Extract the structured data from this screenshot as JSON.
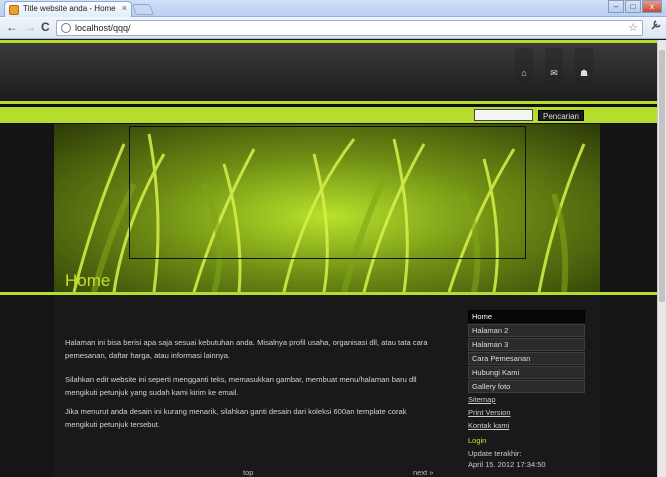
{
  "browser": {
    "tab_title": "Title website anda - Home",
    "tab_close": "×",
    "url": "localhost/qqq/",
    "icons": {
      "back": "←",
      "forward": "→",
      "reload": "C",
      "star": "☆",
      "wrench": "🔧",
      "minimize": "–",
      "maximize": "□",
      "close": "x"
    }
  },
  "header": {
    "icons": [
      "⌂",
      "✉",
      "☗"
    ]
  },
  "search": {
    "input_value": "",
    "button_label": "Pencarian"
  },
  "main": {
    "title": "Home",
    "paragraphs": [
      "Halaman ini bisa berisi apa saja sesuai kebutuhan anda. Misalnya profil usaha, organisasi dll, atau tata cara pemesanan, daftar harga, atau informasi lainnya.",
      "Silahkan edit website ini seperti mengganti teks, memasukkan gambar, membuat menu/halaman baru dll mengikuti petunjuk yang sudah kami kirim ke email.",
      "Jika menurut anda desain ini kurang menarik, silahkan ganti desain dari koleksi 600an template corak mengikuti petunjuk tersebut."
    ],
    "footer_top": "top",
    "footer_next": "next »"
  },
  "sidebar": {
    "menu": [
      "Home",
      "Halaman 2",
      "Halaman 3",
      "Cara Pemesanan",
      "Hubungi Kami",
      "Gallery foto"
    ],
    "links": [
      "Sitemap",
      "Print Version",
      "Kontak kami"
    ],
    "login": "Login",
    "updated_label": "Update terakhir:",
    "updated_value": "April 15. 2012 17:34:50"
  },
  "colors": {
    "accent": "#b6dc2d",
    "title": "#c4e02c"
  }
}
